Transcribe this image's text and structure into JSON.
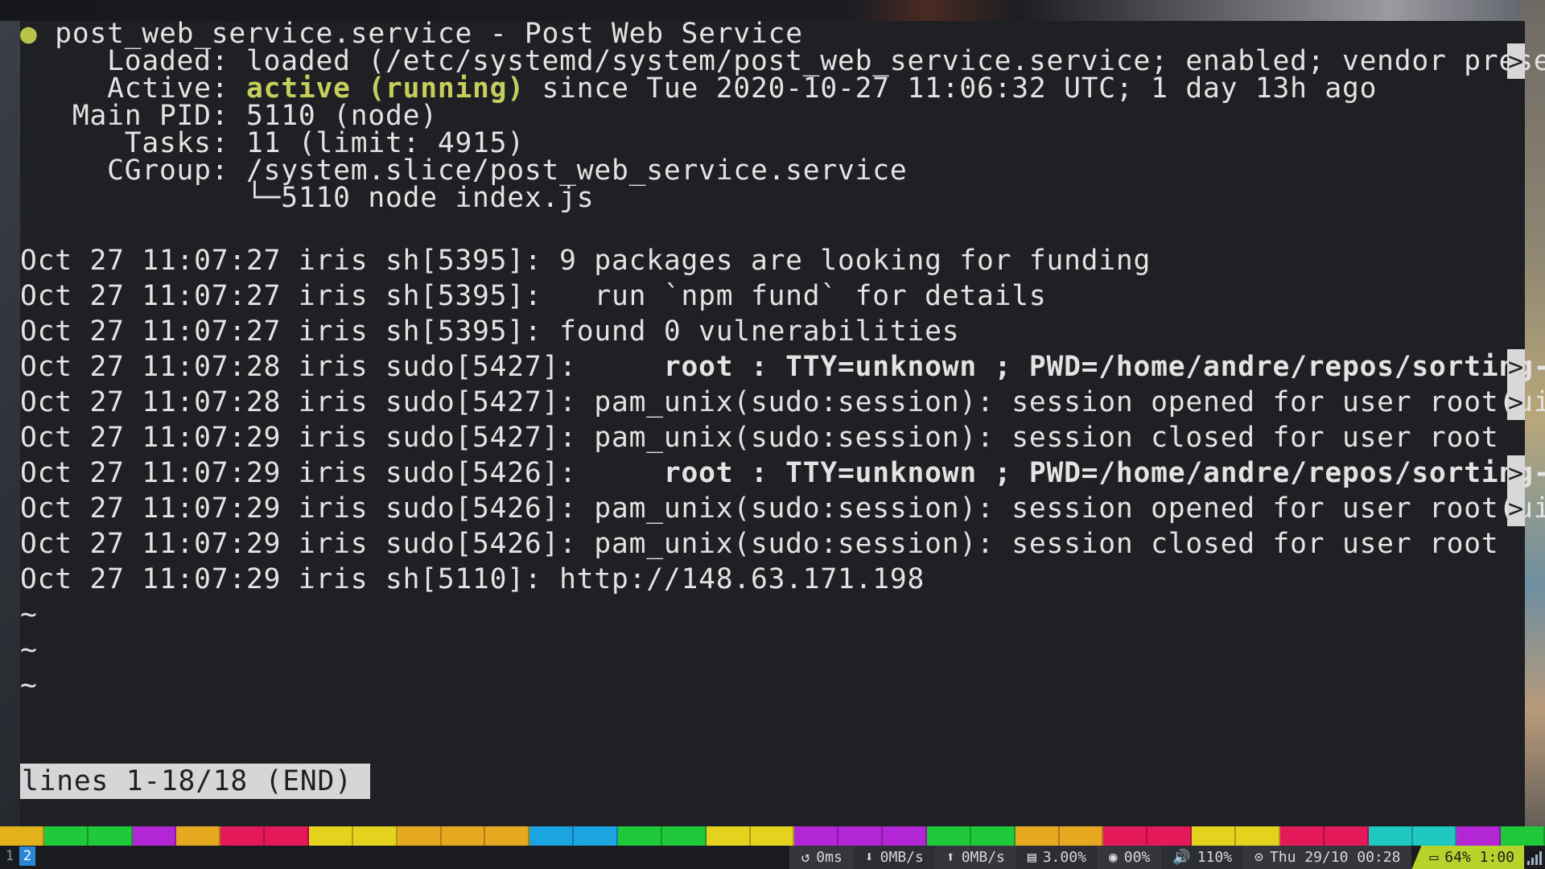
{
  "terminal": {
    "header": {
      "dot": "●",
      "title": "post_web_service.service - Post Web Service"
    },
    "loaded": {
      "label": "     Loaded: ",
      "value": "loaded (/etc/systemd/system/post_web_service.service; enabled; vendor prese"
    },
    "active": {
      "label": "     Active: ",
      "state": "active (running)",
      "rest": " since Tue 2020-10-27 11:06:32 UTC; 1 day 13h ago"
    },
    "main_pid": {
      "label": "   Main PID: ",
      "value": "5110 (node)"
    },
    "tasks": {
      "label": "      Tasks: ",
      "value": "11 (limit: 4915)"
    },
    "cgroup": {
      "label": "     CGroup: ",
      "value": "/system.slice/post_web_service.service",
      "child": "             └─5110 node index.js"
    },
    "log": {
      "l1": "Oct 27 11:07:27 iris sh[5395]: 9 packages are looking for funding",
      "l2": "Oct 27 11:07:27 iris sh[5395]:   run `npm fund` for details",
      "l3": "Oct 27 11:07:27 iris sh[5395]: found 0 vulnerabilities",
      "l4_prefix": "Oct 27 11:07:28 iris sudo[5427]:     ",
      "l4_bold": "root : TTY=unknown ; PWD=/home/andre/repos/sorting-",
      "l5": "Oct 27 11:07:28 iris sudo[5427]: pam_unix(sudo:session): session opened for user root(ui",
      "l6": "Oct 27 11:07:29 iris sudo[5427]: pam_unix(sudo:session): session closed for user root",
      "l7_prefix": "Oct 27 11:07:29 iris sudo[5426]:     ",
      "l7_bold": "root : TTY=unknown ; PWD=/home/andre/repos/sorting-",
      "l8": "Oct 27 11:07:29 iris sudo[5426]: pam_unix(sudo:session): session opened for user root(ui",
      "l9": "Oct 27 11:07:29 iris sudo[5426]: pam_unix(sudo:session): session closed for user root",
      "l10": "Oct 27 11:07:29 iris sh[5110]: http://148.63.171.198"
    },
    "tilde": "~",
    "trunc_marker": ">",
    "pager_status": "lines 1-18/18 (END)"
  },
  "workspaces": {
    "ws1": "1",
    "ws2": "2"
  },
  "statusbar": {
    "ping_icon": "↺",
    "ping": "0ms",
    "down_icon": "⬇",
    "down": "0MB/s",
    "up_icon": "⬆",
    "up": "0MB/s",
    "cpu_icon": "▤",
    "cpu": "3.00%",
    "gpu_icon": "◉",
    "gpu": "00%",
    "volume_icon": "🔊",
    "volume": "110%",
    "clock_icon": "⊙",
    "clock": "Thu 29/10 00:28",
    "battery_icon": "▭",
    "battery": "64% 1:00"
  },
  "colors": {
    "active_state": "#c6cf5b",
    "battery_bg": "#b7d22a",
    "workspace_active": "#2a86d6",
    "strip": [
      "#e2b21b",
      "#20c93a",
      "#20c93a",
      "#b326d6",
      "#e5a81f",
      "#e4195a",
      "#e4195a",
      "#e5d21e",
      "#e5d21e",
      "#e5a81f",
      "#e5a81f",
      "#e5a81f",
      "#1aa4e0",
      "#1aa4e0",
      "#20c93a",
      "#20c93a",
      "#e5d21e",
      "#e5d21e",
      "#b326d6",
      "#b326d6",
      "#b326d6",
      "#20c93a",
      "#20c93a",
      "#e5a81f",
      "#e5a81f",
      "#e4195a",
      "#e4195a",
      "#e5d21e",
      "#e5d21e",
      "#e4195a",
      "#e4195a",
      "#20c9c0",
      "#20c9c0",
      "#b326d6",
      "#20c93a"
    ]
  }
}
